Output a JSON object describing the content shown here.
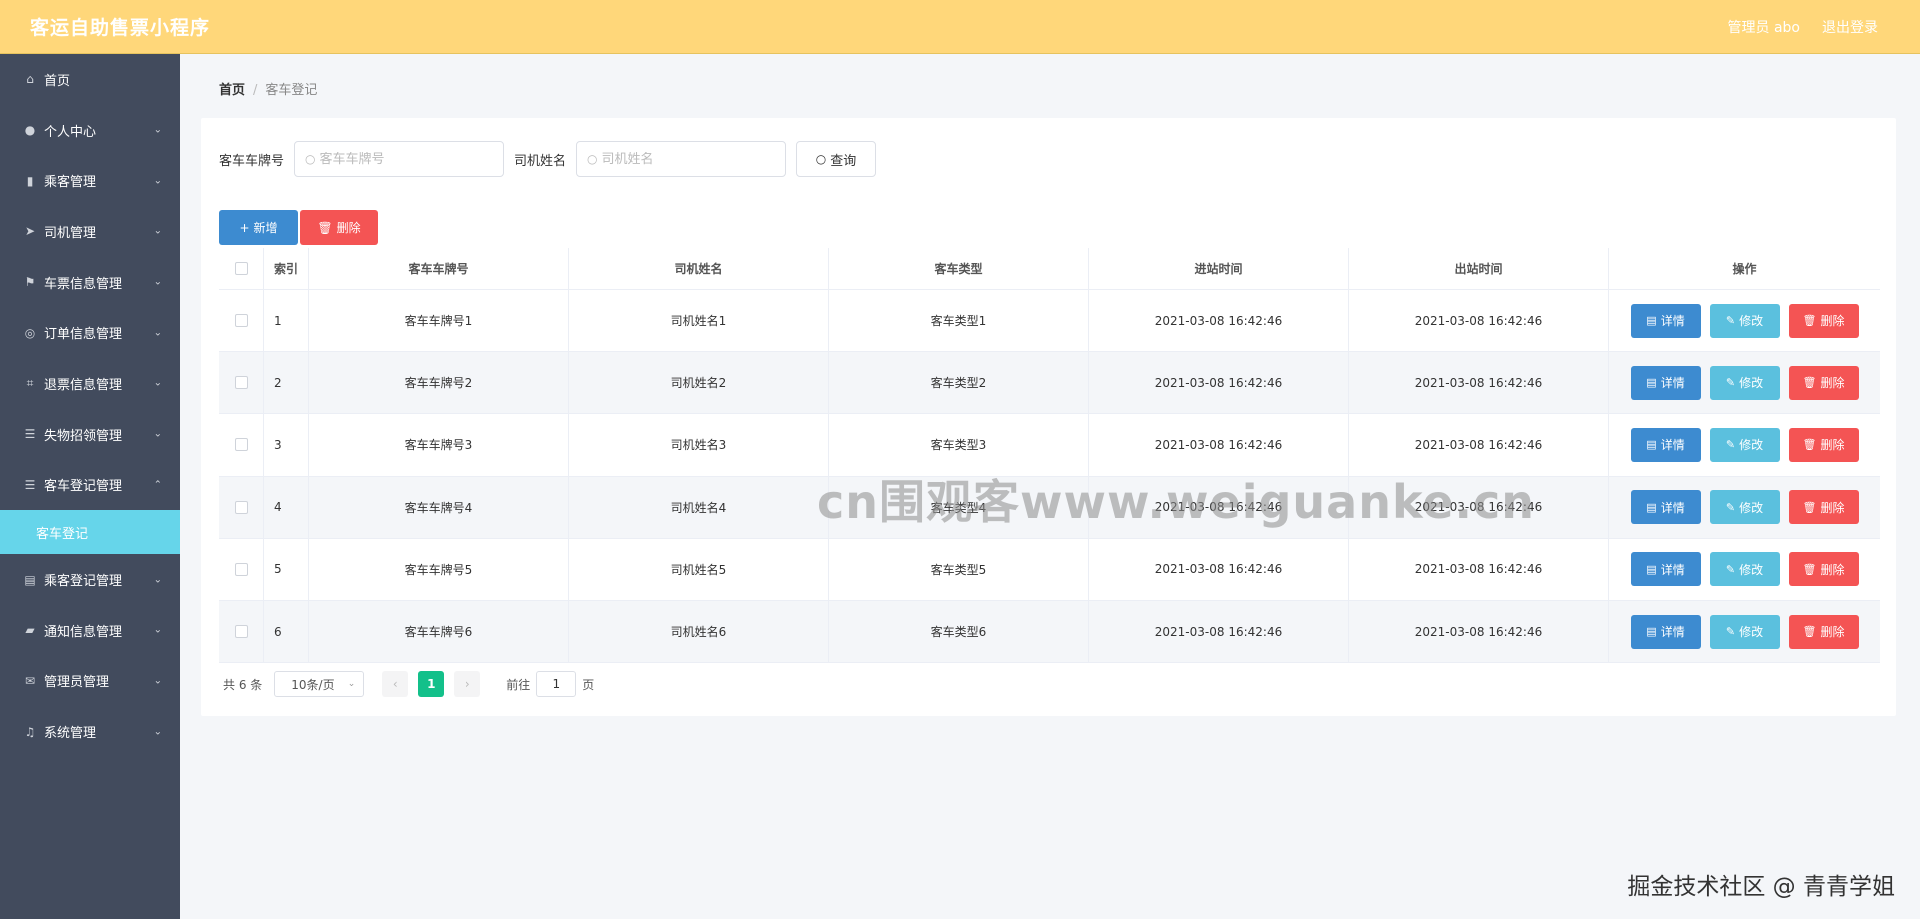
{
  "header": {
    "title": "客运自助售票小程序",
    "admin_label": "管理员 abo",
    "logout_label": "退出登录"
  },
  "sidebar": {
    "items": [
      {
        "label": "首页",
        "icon": "home-icon",
        "chevron": ""
      },
      {
        "label": "个人中心",
        "icon": "user-icon",
        "chevron": "⌄"
      },
      {
        "label": "乘客管理",
        "icon": "bar-chart-icon",
        "chevron": "⌄"
      },
      {
        "label": "司机管理",
        "icon": "send-icon",
        "chevron": "⌄"
      },
      {
        "label": "车票信息管理",
        "icon": "flag-icon",
        "chevron": "⌄"
      },
      {
        "label": "订单信息管理",
        "icon": "circle-icon",
        "chevron": "⌄"
      },
      {
        "label": "退票信息管理",
        "icon": "crop-icon",
        "chevron": "⌄"
      },
      {
        "label": "失物招领管理",
        "icon": "menu-icon",
        "chevron": "⌄"
      },
      {
        "label": "客车登记管理",
        "icon": "menu-icon",
        "chevron": "⌃"
      }
    ],
    "active_sub": "客车登记",
    "items_after": [
      {
        "label": "乘客登记管理",
        "icon": "clipboard-icon",
        "chevron": "⌄"
      },
      {
        "label": "通知信息管理",
        "icon": "ticket-icon",
        "chevron": "⌄"
      },
      {
        "label": "管理员管理",
        "icon": "mail-icon",
        "chevron": "⌄"
      },
      {
        "label": "系统管理",
        "icon": "bell-icon",
        "chevron": "⌄"
      }
    ]
  },
  "breadcrumb": {
    "home": "首页",
    "sep": "/",
    "current": "客车登记"
  },
  "search": {
    "plate_label": "客车车牌号",
    "plate_placeholder": "客车车牌号",
    "driver_label": "司机姓名",
    "driver_placeholder": "司机姓名",
    "query_label": "查询"
  },
  "actions": {
    "add_label": "新增",
    "delete_label": "删除"
  },
  "table": {
    "headers": [
      "索引",
      "客车车牌号",
      "司机姓名",
      "客车类型",
      "进站时间",
      "出站时间",
      "操作"
    ],
    "rows": [
      {
        "idx": "1",
        "plate": "客车车牌号1",
        "driver": "司机姓名1",
        "type": "客车类型1",
        "in": "2021-03-08 16:42:46",
        "out": "2021-03-08 16:42:46"
      },
      {
        "idx": "2",
        "plate": "客车车牌号2",
        "driver": "司机姓名2",
        "type": "客车类型2",
        "in": "2021-03-08 16:42:46",
        "out": "2021-03-08 16:42:46"
      },
      {
        "idx": "3",
        "plate": "客车车牌号3",
        "driver": "司机姓名3",
        "type": "客车类型3",
        "in": "2021-03-08 16:42:46",
        "out": "2021-03-08 16:42:46"
      },
      {
        "idx": "4",
        "plate": "客车车牌号4",
        "driver": "司机姓名4",
        "type": "客车类型4",
        "in": "2021-03-08 16:42:46",
        "out": "2021-03-08 16:42:46"
      },
      {
        "idx": "5",
        "plate": "客车车牌号5",
        "driver": "司机姓名5",
        "type": "客车类型5",
        "in": "2021-03-08 16:42:46",
        "out": "2021-03-08 16:42:46"
      },
      {
        "idx": "6",
        "plate": "客车车牌号6",
        "driver": "司机姓名6",
        "type": "客车类型6",
        "in": "2021-03-08 16:42:46",
        "out": "2021-03-08 16:42:46"
      }
    ],
    "op_labels": {
      "detail": "详情",
      "edit": "修改",
      "delete": "删除"
    }
  },
  "pagination": {
    "total": "共 6 条",
    "page_size": "10条/页",
    "current_page": "1",
    "goto_prefix": "前往",
    "goto_value": "1",
    "goto_suffix": "页"
  },
  "watermark": "cn围观客www.weiguanke.cn",
  "corner_mark": "掘金技术社区 @ 青青学姐",
  "colors": {
    "header_bg": "#ffd77a",
    "sidebar_bg": "#424b5d",
    "sidebar_active": "#66d5ea",
    "primary": "#3d8bd0",
    "info": "#5bc0de",
    "danger": "#f45454",
    "pager_active": "#13c08a"
  }
}
